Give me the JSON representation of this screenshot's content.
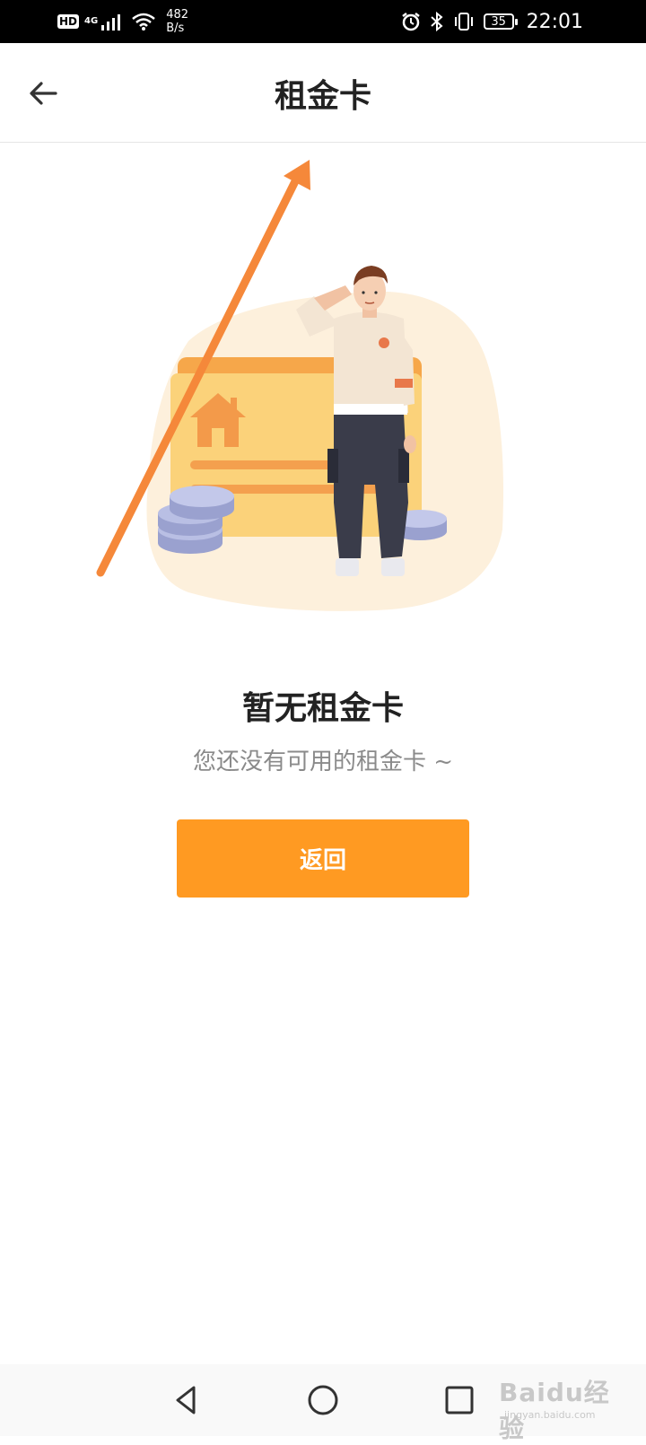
{
  "status_bar": {
    "hd": "HD",
    "network": "4G",
    "speed_value": "482",
    "speed_unit": "B/s",
    "battery": "35",
    "time": "22:01"
  },
  "header": {
    "title": "租金卡"
  },
  "empty_state": {
    "title": "暂无租金卡",
    "subtitle": "您还没有可用的租金卡 ~",
    "button_label": "返回"
  },
  "watermark": {
    "brand": "Baidu经验",
    "url": "jingyan.baidu.com"
  },
  "colors": {
    "accent": "#ff9a22",
    "title_text": "#222222",
    "subtitle_text": "#8a8a8a"
  },
  "icons": {
    "back": "arrow-left-icon",
    "nav_back": "triangle-back-icon",
    "nav_home": "circle-home-icon",
    "nav_recent": "square-recent-icon"
  }
}
